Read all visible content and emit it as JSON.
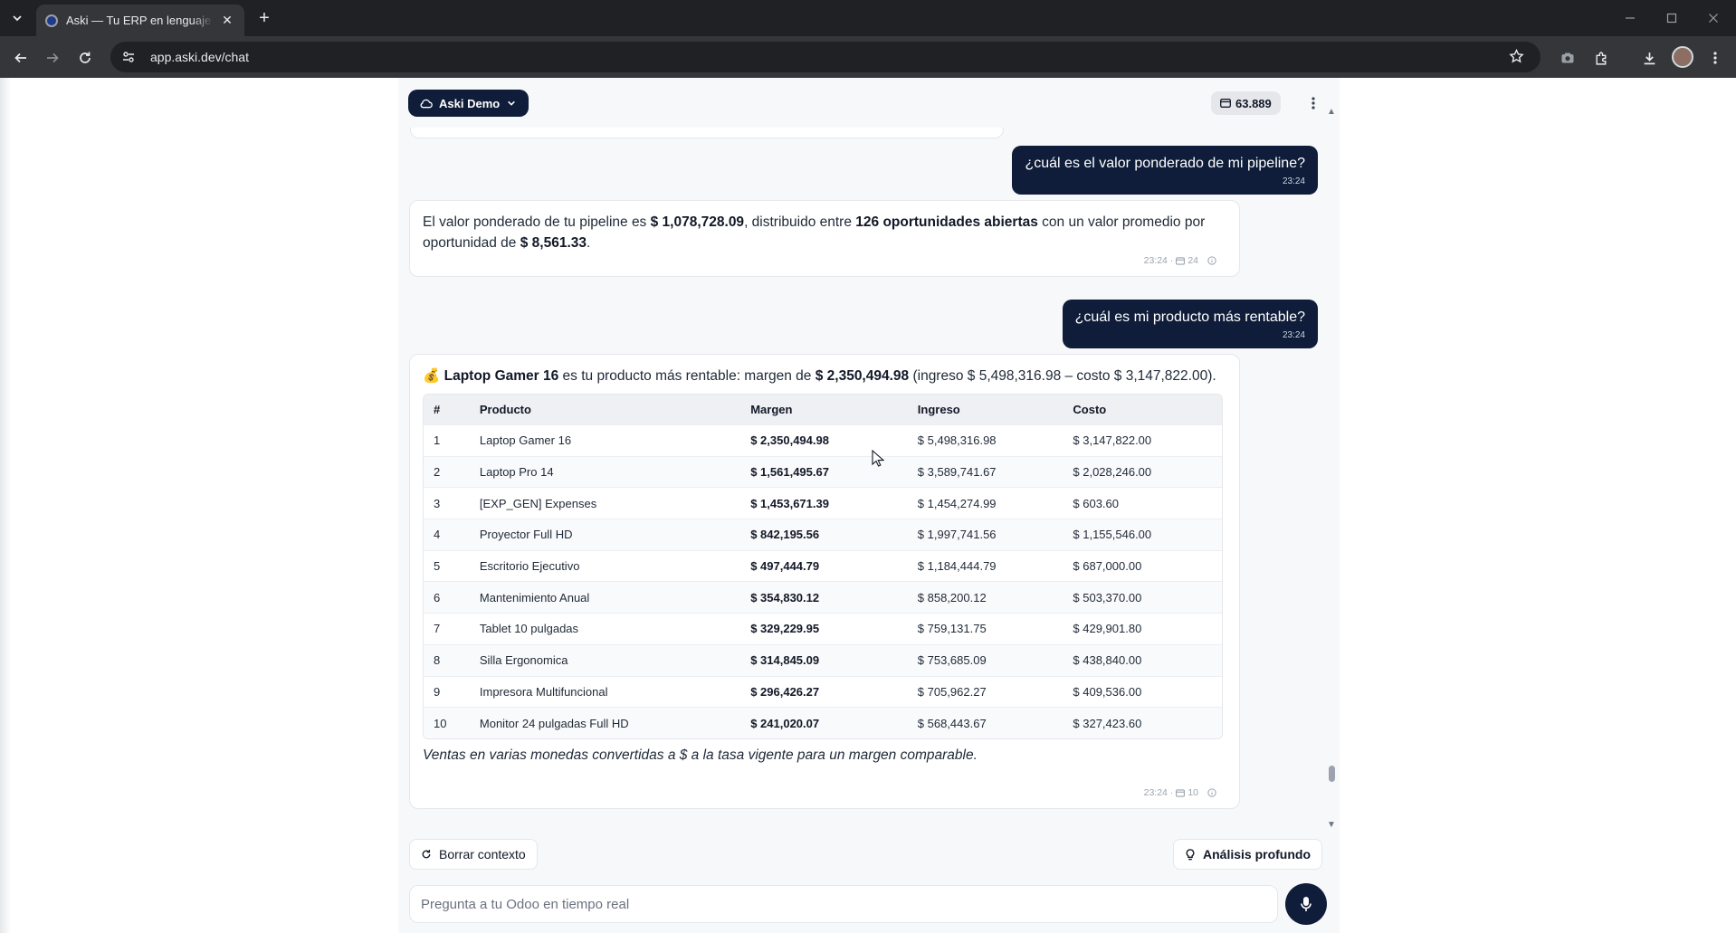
{
  "browser": {
    "tab_title": "Aski — Tu ERP en lenguaje natural",
    "url": "app.aski.dev/chat"
  },
  "header": {
    "company": "Aski Demo",
    "credits": "63.889"
  },
  "messages": {
    "q1": {
      "text": "¿cuál es el valor ponderado de mi pipeline?",
      "time": "23:24"
    },
    "a1": {
      "part1": "El valor ponderado de tu pipeline es ",
      "value": "$ 1,078,728.09",
      "part2": ", distribuido entre ",
      "count": "126 oportunidades abiertas",
      "part3": " con un valor promedio por oportunidad de ",
      "avg": "$ 8,561.33",
      "part4": ".",
      "time": "23:24 ·",
      "records": "24"
    },
    "q2": {
      "text": "¿cuál es mi producto más rentable?",
      "time": "23:24"
    },
    "a2": {
      "emoji": "💰",
      "product": "Laptop Gamer 16",
      "part1": " es tu producto más rentable: margen de ",
      "margin": "$ 2,350,494.98",
      "part2": " (ingreso $ 5,498,316.98 – costo $ 3,147,822.00).",
      "table": {
        "headers": [
          "#",
          "Producto",
          "Margen",
          "Ingreso",
          "Costo"
        ],
        "rows": [
          [
            "1",
            "Laptop Gamer 16",
            "$ 2,350,494.98",
            "$ 5,498,316.98",
            "$ 3,147,822.00"
          ],
          [
            "2",
            "Laptop Pro 14",
            "$ 1,561,495.67",
            "$ 3,589,741.67",
            "$ 2,028,246.00"
          ],
          [
            "3",
            "[EXP_GEN] Expenses",
            "$ 1,453,671.39",
            "$ 1,454,274.99",
            "$ 603.60"
          ],
          [
            "4",
            "Proyector Full HD",
            "$ 842,195.56",
            "$ 1,997,741.56",
            "$ 1,155,546.00"
          ],
          [
            "5",
            "Escritorio Ejecutivo",
            "$ 497,444.79",
            "$ 1,184,444.79",
            "$ 687,000.00"
          ],
          [
            "6",
            "Mantenimiento Anual",
            "$ 354,830.12",
            "$ 858,200.12",
            "$ 503,370.00"
          ],
          [
            "7",
            "Tablet 10 pulgadas",
            "$ 329,229.95",
            "$ 759,131.75",
            "$ 429,901.80"
          ],
          [
            "8",
            "Silla Ergonomica",
            "$ 314,845.09",
            "$ 753,685.09",
            "$ 438,840.00"
          ],
          [
            "9",
            "Impresora Multifuncional",
            "$ 296,426.27",
            "$ 705,962.27",
            "$ 409,536.00"
          ],
          [
            "10",
            "Monitor 24 pulgadas Full HD",
            "$ 241,020.07",
            "$ 568,443.67",
            "$ 327,423.60"
          ]
        ]
      },
      "note": "Ventas en varias monedas convertidas a $ a la tasa vigente para un margen comparable.",
      "time": "23:24 ·",
      "records": "10"
    }
  },
  "actions": {
    "clear": "Borrar contexto",
    "deep": "Análisis profundo"
  },
  "composer": {
    "placeholder": "Pregunta a tu Odoo en tiempo real"
  }
}
